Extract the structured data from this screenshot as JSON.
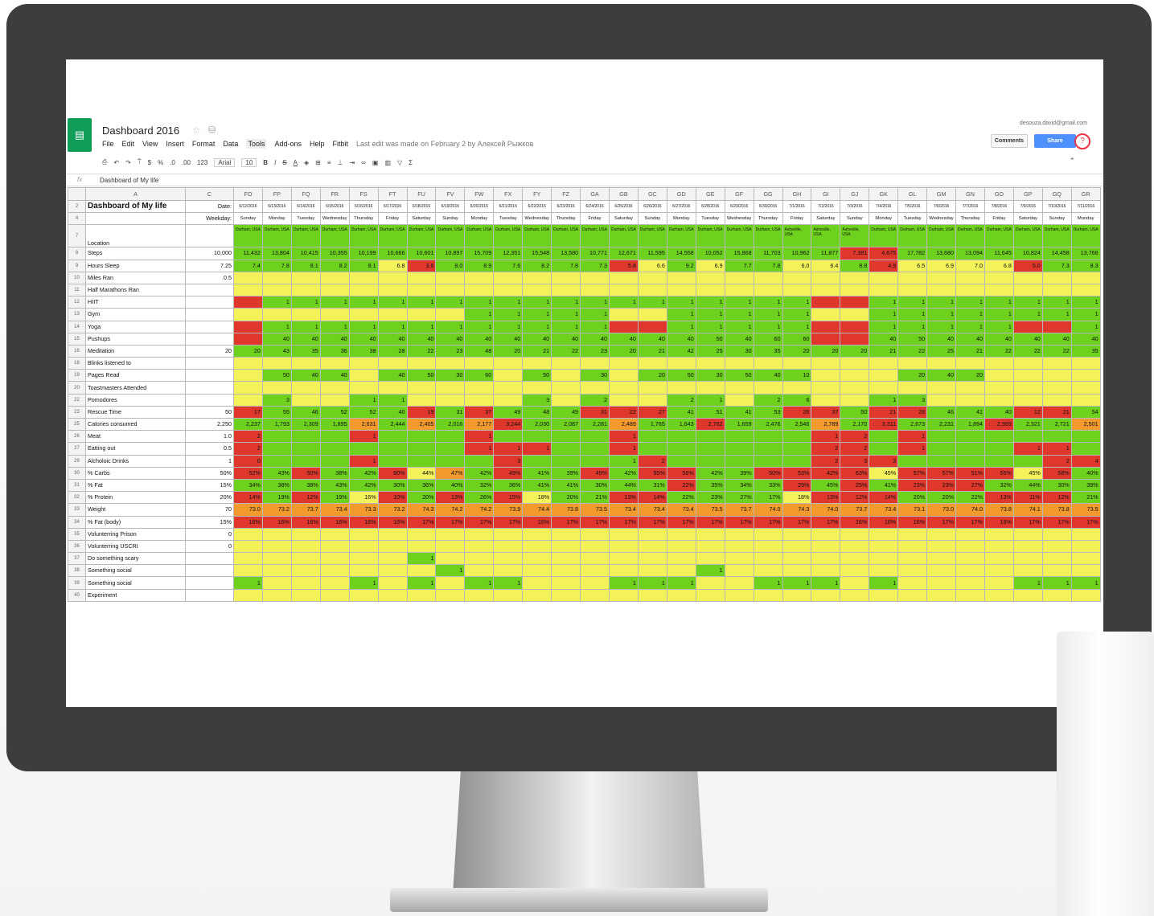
{
  "app": {
    "title": "Dashboard 2016",
    "menu": [
      "File",
      "Edit",
      "View",
      "Insert",
      "Format",
      "Data",
      "Tools",
      "Add-ons",
      "Help",
      "Fitbit"
    ],
    "last_edit": "Last edit was made on February 2 by Алексей Рыжков",
    "account": "desouza.david@gmail.com",
    "comments_label": "Comments",
    "share_label": "Share",
    "help_icon": "?",
    "logo_icon": "sheets-logo-icon"
  },
  "toolbar": {
    "zoom": "123",
    "font": "Arial",
    "size": "10",
    "currency": "$",
    "percent": "%",
    "dec_less": ".0",
    "dec_more": ".00"
  },
  "formula_bar": {
    "fx": "fx",
    "value": "Dashboard of My life"
  },
  "columns": {
    "left": [
      "A",
      "C"
    ],
    "data": [
      "FO",
      "FP",
      "FQ",
      "FR",
      "FS",
      "FT",
      "FU",
      "FV",
      "FW",
      "FX",
      "FY",
      "FZ",
      "GA",
      "GB",
      "GC",
      "GD",
      "GE",
      "GF",
      "GG",
      "GH",
      "GI",
      "GJ",
      "GK",
      "GL",
      "GM",
      "GN",
      "GO",
      "GP",
      "GQ",
      "GR"
    ]
  },
  "header_rows": {
    "title": "Dashboard of My life",
    "date_label": "Date:",
    "weekday_label": "Weekday:",
    "location_label": "Location",
    "dates": [
      "6/12/2016",
      "6/13/2016",
      "6/14/2016",
      "6/15/2016",
      "6/16/2016",
      "6/17/2016",
      "6/18/2016",
      "6/19/2016",
      "6/20/2016",
      "6/21/2016",
      "6/22/2016",
      "6/23/2016",
      "6/24/2016",
      "6/25/2016",
      "6/26/2016",
      "6/27/2016",
      "6/28/2016",
      "6/29/2016",
      "6/30/2016",
      "7/1/2016",
      "7/2/2016",
      "7/3/2016",
      "7/4/2016",
      "7/5/2016",
      "7/6/2016",
      "7/7/2016",
      "7/8/2016",
      "7/9/2016",
      "7/10/2016",
      "7/11/2016"
    ],
    "weekdays": [
      "Sunday",
      "Monday",
      "Tuesday",
      "Wednesday",
      "Thursday",
      "Friday",
      "Saturday",
      "Sunday",
      "Monday",
      "Tuesday",
      "Wednesday",
      "Thursday",
      "Friday",
      "Saturday",
      "Sunday",
      "Monday",
      "Tuesday",
      "Wednesday",
      "Thursday",
      "Friday",
      "Saturday",
      "Sunday",
      "Monday",
      "Tuesday",
      "Wednesday",
      "Thursday",
      "Friday",
      "Saturday",
      "Sunday",
      "Monday"
    ],
    "locations": [
      "Durham, USA",
      "Durham, USA",
      "Durham, USA",
      "Durham, USA",
      "Durham, USA",
      "Durham, USA",
      "Durham, USA",
      "Durham, USA",
      "Durham, USA",
      "Durham, USA",
      "Durham, USA",
      "Durham, USA",
      "Durham, USA",
      "Durham, USA",
      "Durham, USA",
      "Durham, USA",
      "Durham, USA",
      "Durham, USA",
      "Durham, USA",
      "Asheville, USA",
      "Asheville, USA",
      "Asheville, USA",
      "Durham, USA",
      "Durham, USA",
      "Durham, USA",
      "Durham, USA",
      "Durham, USA",
      "Durham, USA",
      "Durham, USA",
      "Durham, USA"
    ]
  },
  "rows": [
    {
      "n": "8",
      "label": "Steps",
      "target": "10,000",
      "values": [
        "11,432",
        "13,804",
        "10,415",
        "10,355",
        "10,199",
        "10,666",
        "10,601",
        "10,897",
        "15,709",
        "12,351",
        "15,548",
        "13,580",
        "10,771",
        "12,671",
        "11,595",
        "14,558",
        "10,052",
        "15,868",
        "11,703",
        "10,962",
        "11,877",
        "7,381",
        "4,675",
        "17,782",
        "13,680",
        "13,094",
        "11,645",
        "10,824",
        "14,458",
        "13,766"
      ],
      "colors": "GGGGGGGGGGGGGGGGGGGGGRRGGGGGGG"
    },
    {
      "n": "9",
      "label": "Hours Sleep",
      "target": "7.25",
      "values": [
        "7.4",
        "7.8",
        "8.1",
        "8.2",
        "8.1",
        "6.8",
        "3.6",
        "8.0",
        "8.9",
        "7.6",
        "8.2",
        "7.8",
        "7.3",
        "5.8",
        "6.6",
        "9.2",
        "6.9",
        "7.7",
        "7.8",
        "6.0",
        "6.4",
        "8.8",
        "4.9",
        "6.5",
        "6.9",
        "7.0",
        "6.8",
        "5.0",
        "7.3",
        "8.3"
      ],
      "colors": "GGGGGYRGGGGGGRYGYGGYYGRYYYYRGG"
    },
    {
      "n": "10",
      "label": "Miles Ran",
      "target": "0.5",
      "values": [],
      "colors": "YYYYYYYYYYYYYYYYYYYYYYYYYYYYYY"
    },
    {
      "n": "11",
      "label": "Half Marathons Ran",
      "target": "",
      "values": [],
      "colors": "YYYYYYYYYYYYYYYYYYYYYYYYYYYYYY"
    },
    {
      "n": "12",
      "label": "HIIT",
      "target": "",
      "values": [
        "",
        "1",
        "1",
        "1",
        "1",
        "1",
        "1",
        "1",
        "1",
        "1",
        "1",
        "1",
        "1",
        "1",
        "1",
        "1",
        "1",
        "1",
        "1",
        "1",
        "",
        "",
        "1",
        "1",
        "1",
        "1",
        "1",
        "1",
        "1",
        "1"
      ],
      "colors": "RGGGGGGGGGGGGGGGGGGGRRGGGGGGGG"
    },
    {
      "n": "13",
      "label": "Gym",
      "target": "",
      "values": [
        "",
        "",
        "",
        "",
        "",
        "",
        "",
        "",
        "1",
        "1",
        "1",
        "1",
        "1",
        "",
        "",
        "1",
        "1",
        "1",
        "1",
        "1",
        "",
        "",
        "1",
        "1",
        "1",
        "1",
        "1",
        "1",
        "1",
        "1"
      ],
      "colors": "YYYYYYYYGGGGGYYGGGGGYYGGGGGGGG"
    },
    {
      "n": "14",
      "label": "Yoga",
      "target": "",
      "values": [
        "",
        "1",
        "1",
        "1",
        "1",
        "1",
        "1",
        "1",
        "1",
        "1",
        "1",
        "1",
        "1",
        "",
        "",
        "1",
        "1",
        "1",
        "1",
        "1",
        "",
        "",
        "1",
        "1",
        "1",
        "1",
        "1",
        "",
        "",
        "1"
      ],
      "colors": "RGGGGGGGGGGGGRRGGGGGRRGGGGGRRG"
    },
    {
      "n": "15",
      "label": "Pushups",
      "target": "",
      "values": [
        "",
        "40",
        "40",
        "40",
        "40",
        "40",
        "40",
        "40",
        "40",
        "40",
        "40",
        "40",
        "40",
        "40",
        "40",
        "40",
        "50",
        "40",
        "60",
        "60",
        "",
        "",
        "40",
        "50",
        "40",
        "40",
        "40",
        "40",
        "40",
        "40"
      ],
      "colors": "RGGGGGGGGGGGGGGGGGGGRRGGGGGGGG"
    },
    {
      "n": "16",
      "label": "Meditation",
      "target": "20",
      "values": [
        "20",
        "43",
        "35",
        "36",
        "38",
        "28",
        "22",
        "23",
        "48",
        "20",
        "21",
        "22",
        "23",
        "20",
        "21",
        "42",
        "25",
        "30",
        "35",
        "20",
        "20",
        "20",
        "21",
        "22",
        "25",
        "21",
        "22",
        "22",
        "22",
        "35"
      ],
      "colors": "GGGGGGGGGGGGGGGGGGGGGGGGGGGGGG"
    },
    {
      "n": "18",
      "label": "Blinks listened to",
      "target": "",
      "values": [],
      "colors": "YYYYYYYYYYYYYYYYYYYYYYYYYYYYYY"
    },
    {
      "n": "19",
      "label": "Pages Read",
      "target": "",
      "values": [
        "",
        "50",
        "40",
        "40",
        "",
        "40",
        "50",
        "30",
        "60",
        "",
        "50",
        "",
        "30",
        "",
        "20",
        "50",
        "30",
        "50",
        "40",
        "10",
        "",
        "",
        "",
        "20",
        "40",
        "20",
        "",
        "",
        "",
        ""
      ],
      "colors": "YGGGYGGGGYGYGYGGGGGGYYYGGGYYYY"
    },
    {
      "n": "20",
      "label": "Toastmasters Attended",
      "target": "",
      "values": [],
      "colors": "YYYYYYYYYYYYYYYYYYYYYYYYYYYYYY"
    },
    {
      "n": "22",
      "label": "Pomodores",
      "target": "",
      "values": [
        "",
        "3",
        "",
        "",
        "1",
        "1",
        "",
        "",
        "",
        "",
        "3",
        "",
        "2",
        "",
        "",
        "2",
        "1",
        "",
        "2",
        "6",
        "",
        "",
        "1",
        "3",
        "",
        "",
        "",
        "",
        "",
        ""
      ],
      "colors": "YGYYGGYYYYGYGYYGGYGGYYGGYYYYYY"
    },
    {
      "n": "23",
      "label": "Rescue Time",
      "target": "50",
      "values": [
        "17",
        "55",
        "46",
        "52",
        "52",
        "40",
        "19",
        "31",
        "37",
        "49",
        "48",
        "49",
        "31",
        "22",
        "27",
        "41",
        "51",
        "41",
        "53",
        "26",
        "37",
        "50",
        "21",
        "28",
        "46",
        "41",
        "40",
        "12",
        "21",
        "54"
      ],
      "colors": "RGGGGGRGRGGGRRRGGGGRRGRRGGGRRG"
    },
    {
      "n": "25",
      "label": "Calories consumed",
      "target": "2,250",
      "values": [
        "2,237",
        "1,793",
        "2,309",
        "1,895",
        "2,631",
        "2,444",
        "2,405",
        "2,016",
        "2,177",
        "3,244",
        "2,030",
        "2,087",
        "2,281",
        "2,489",
        "1,765",
        "1,643",
        "2,762",
        "1,659",
        "2,476",
        "2,546",
        "2,789",
        "2,170",
        "3,311",
        "2,673",
        "2,231",
        "1,894",
        "2,969",
        "2,321",
        "2,721",
        "2,501"
      ],
      "colors": "GGGGOGOGORGGGOGGRGGGOGRGGGRGGO"
    },
    {
      "n": "26",
      "label": "Meat",
      "target": "1.0",
      "values": [
        "2",
        "",
        "",
        "",
        "1",
        "",
        "",
        "",
        "1",
        "",
        "",
        "",
        "",
        "1",
        "",
        "",
        "",
        "",
        "",
        "",
        "1",
        "2",
        "",
        "1",
        "",
        "",
        "",
        "",
        "",
        ""
      ],
      "colors": "RGGGRGGGRGGGGRGGGGGGRRGRGGGGGG"
    },
    {
      "n": "27",
      "label": "Eatting out",
      "target": "0.5",
      "values": [
        "2",
        "",
        "",
        "",
        "",
        "",
        "",
        "",
        "1",
        "1",
        "1",
        "",
        "",
        "1",
        "",
        "",
        "",
        "",
        "",
        "",
        "2",
        "2",
        "",
        "1",
        "",
        "",
        "",
        "1",
        "1",
        ""
      ],
      "colors": "RGGGGGGGRRRGGRGGGGGGRRGRGGGRRG"
    },
    {
      "n": "29",
      "label": "Alcholoic Drinks",
      "target": "1",
      "values": [
        "0",
        "",
        "",
        "",
        "1",
        "",
        "",
        "",
        "",
        "3",
        "",
        "",
        "",
        "1",
        "2",
        "",
        "",
        "",
        "",
        "",
        "2",
        "3",
        "3",
        "",
        "",
        "",
        "",
        "",
        "2",
        "4"
      ],
      "colors": "RGGGRGGGGRGGGGRGGGGGRRRGGGGGRR"
    },
    {
      "n": "30",
      "label": "% Carbs",
      "target": "50%",
      "values": [
        "52%",
        "43%",
        "50%",
        "38%",
        "42%",
        "60%",
        "44%",
        "47%",
        "42%",
        "49%",
        "41%",
        "39%",
        "49%",
        "42%",
        "55%",
        "56%",
        "42%",
        "39%",
        "50%",
        "53%",
        "42%",
        "63%",
        "45%",
        "57%",
        "57%",
        "51%",
        "55%",
        "45%",
        "58%",
        "40%"
      ],
      "colors": "RGRGGRYOGRGGRGRRGGRRRRYRRRRYRG"
    },
    {
      "n": "31",
      "label": "% Fat",
      "target": "15%",
      "values": [
        "34%",
        "38%",
        "38%",
        "43%",
        "42%",
        "30%",
        "36%",
        "40%",
        "32%",
        "36%",
        "41%",
        "41%",
        "30%",
        "44%",
        "31%",
        "22%",
        "35%",
        "34%",
        "33%",
        "29%",
        "45%",
        "25%",
        "41%",
        "23%",
        "23%",
        "27%",
        "32%",
        "44%",
        "30%",
        "39%"
      ],
      "colors": "GGGGGGGGGGGGGGGRGGGRGRGRRRGGGG"
    },
    {
      "n": "32",
      "label": "% Protein",
      "target": "20%",
      "values": [
        "14%",
        "19%",
        "12%",
        "19%",
        "16%",
        "10%",
        "20%",
        "13%",
        "26%",
        "15%",
        "18%",
        "20%",
        "21%",
        "13%",
        "14%",
        "22%",
        "23%",
        "27%",
        "17%",
        "18%",
        "13%",
        "12%",
        "14%",
        "20%",
        "20%",
        "22%",
        "13%",
        "11%",
        "12%",
        "21%"
      ],
      "colors": "RGRGYRGRGRYGGRRGGGGYRRRGGGRRRG"
    },
    {
      "n": "33",
      "label": "Weight",
      "target": "70",
      "values": [
        "73.0",
        "73.2",
        "73.7",
        "73.4",
        "73.3",
        "73.2",
        "74.3",
        "74.2",
        "74.2",
        "73.9",
        "74.4",
        "73.8",
        "73.5",
        "73.4",
        "73.4",
        "73.4",
        "73.5",
        "73.7",
        "74.0",
        "74.3",
        "74.0",
        "73.7",
        "73.4",
        "73.1",
        "73.0",
        "74.0",
        "73.8",
        "74.1",
        "73.8",
        "73.5"
      ],
      "colors": "OOOOOOOOOOOOOOOOOOOOOOOOOOOOOO"
    },
    {
      "n": "34",
      "label": "% Fat (body)",
      "target": "15%",
      "values": [
        "16%",
        "16%",
        "16%",
        "16%",
        "16%",
        "16%",
        "17%",
        "17%",
        "17%",
        "17%",
        "16%",
        "17%",
        "17%",
        "17%",
        "17%",
        "17%",
        "17%",
        "17%",
        "17%",
        "17%",
        "17%",
        "16%",
        "16%",
        "16%",
        "17%",
        "17%",
        "16%",
        "17%",
        "17%",
        "17%"
      ],
      "colors": "RRRRRRRRRRRRRRRRRRRRRRRRRRRRRR"
    },
    {
      "n": "35",
      "label": "Volunterring Prison",
      "target": "0",
      "values": [],
      "colors": "YYYYYYYYYYYYYYYYYYYYYYYYYYYYYY"
    },
    {
      "n": "36",
      "label": "Volunterring USCRI",
      "target": "0",
      "values": [],
      "colors": "YYYYYYYYYYYYYYYYYYYYYYYYYYYYYY"
    },
    {
      "n": "37",
      "label": "Do something scary",
      "target": "",
      "values": [
        "",
        "",
        "",
        "",
        "",
        "",
        "1",
        "",
        "",
        "",
        "",
        "",
        "",
        "",
        "",
        "",
        "",
        "",
        "",
        "",
        "",
        "",
        "",
        "",
        "",
        "",
        "",
        "",
        "",
        ""
      ],
      "colors": "YYYYYYGYYYYYYYYYYYYYYYYYYYYYYY"
    },
    {
      "n": "38",
      "label": "Something social",
      "target": "",
      "values": [
        "",
        "",
        "",
        "",
        "",
        "",
        "",
        "1",
        "",
        "",
        "",
        "",
        "",
        "",
        "",
        "",
        "1",
        "",
        "",
        "",
        "",
        "",
        "",
        "",
        "",
        "",
        "",
        "",
        "",
        ""
      ],
      "colors": "YYYYYYYGYYYYYYYYGYYYYYYYYYYYYY"
    },
    {
      "n": "39",
      "label": "Something social",
      "target": "",
      "values": [
        "1",
        "",
        "",
        "",
        "1",
        "",
        "1",
        "",
        "1",
        "1",
        "",
        "",
        "",
        "1",
        "1",
        "1",
        "",
        "",
        "1",
        "1",
        "1",
        "",
        "1",
        "",
        "",
        "",
        "",
        "1",
        "1",
        "1"
      ],
      "colors": "GYYYGYGYGGYYYGGGYYGGGYGYYYYGGG"
    },
    {
      "n": "40",
      "label": "Experiment",
      "target": "",
      "values": [],
      "colors": "YYYYYYYYYYYYYYYYYYYYYYYYYYYYYY"
    }
  ]
}
